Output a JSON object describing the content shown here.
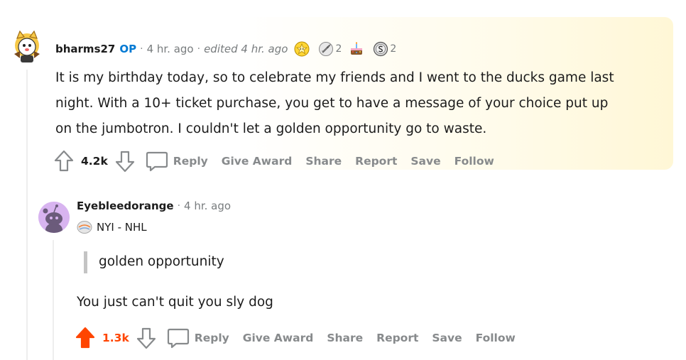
{
  "comment1": {
    "username": "bharms27",
    "op_badge": "OP",
    "separator": "·",
    "time": "4 hr. ago",
    "edited": "edited 4 hr. ago",
    "awards": [
      {
        "icon": "wholesome-award-icon",
        "count": ""
      },
      {
        "icon": "rocket-award-icon",
        "count": "2"
      },
      {
        "icon": "birthday-cake-award-icon",
        "count": ""
      },
      {
        "icon": "silver-coin-award-icon",
        "count": "2"
      }
    ],
    "body_lines": [
      "It is my birthday today, so to celebrate my friends and I went to the ducks game last",
      "night. With a 10+ ticket purchase, you get to have a message of your choice put up",
      "on the jumbotron. I couldn't let a golden opportunity go to waste."
    ],
    "votes": "4.2k",
    "upvoted": false,
    "actions": {
      "reply": "Reply",
      "give_award": "Give Award",
      "share": "Share",
      "report": "Report",
      "save": "Save",
      "follow": "Follow"
    }
  },
  "comment2": {
    "username": "Eyebleedorange",
    "separator": "·",
    "time": "4 hr. ago",
    "flair": "NYI - NHL",
    "quote": "golden opportunity",
    "body": "You just can't quit you sly dog",
    "votes": "1.3k",
    "upvoted": true,
    "actions": {
      "reply": "Reply",
      "give_award": "Give Award",
      "share": "Share",
      "report": "Report",
      "save": "Save",
      "follow": "Follow"
    }
  },
  "colors": {
    "upvote_active": "#ff4500",
    "op_blue": "#0079d3",
    "muted": "#878a8c",
    "highlight": "#fff7d6"
  }
}
